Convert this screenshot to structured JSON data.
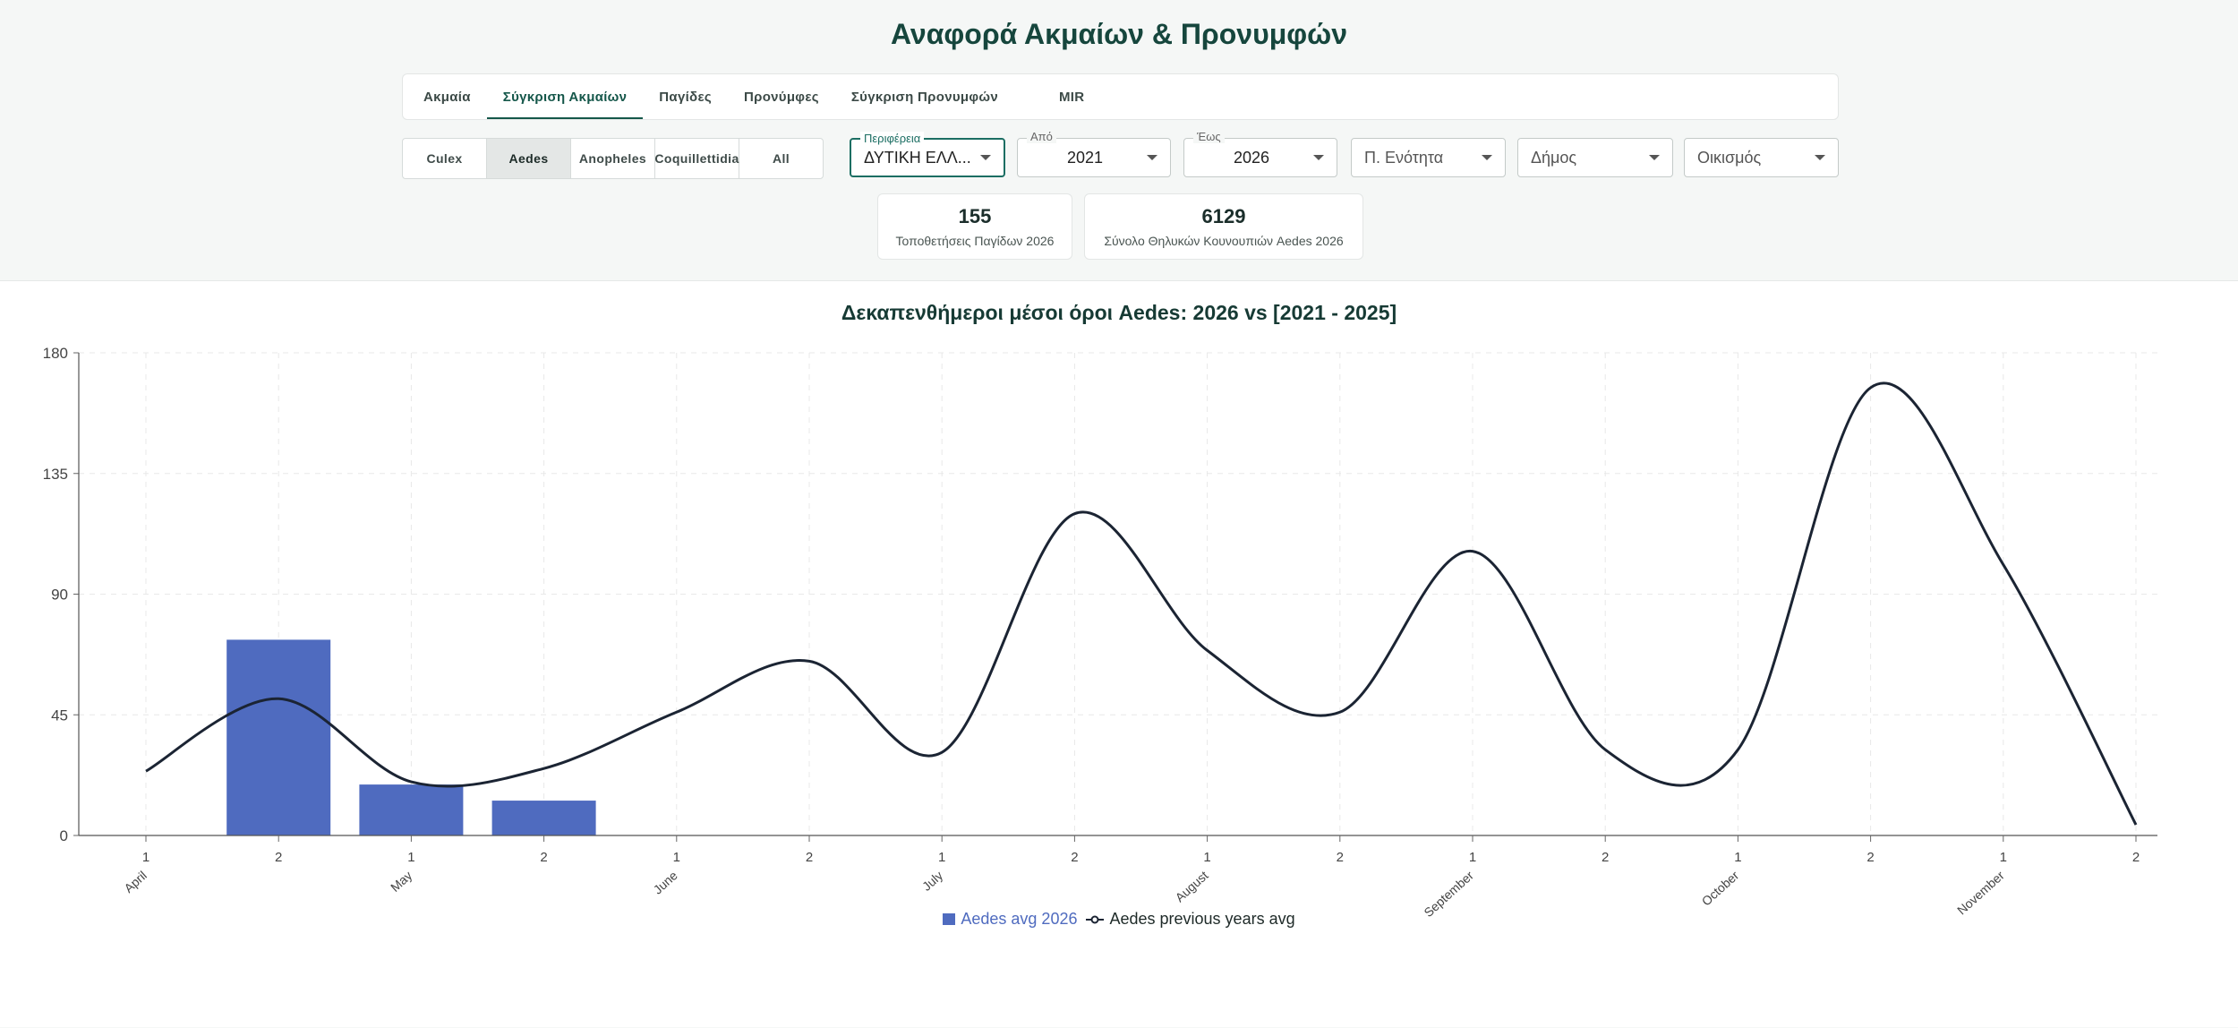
{
  "title": "Αναφορά Ακμαίων & Προνυμφών",
  "tabs": [
    {
      "label": "Ακμαία",
      "active": false
    },
    {
      "label": "Σύγκριση Ακμαίων",
      "active": true
    },
    {
      "label": "Παγίδες",
      "active": false
    },
    {
      "label": "Προνύμφες",
      "active": false
    },
    {
      "label": "Σύγκριση Προνυμφών",
      "active": false
    },
    {
      "label": "MIR",
      "active": false
    }
  ],
  "species": [
    "Culex",
    "Aedes",
    "Anopheles",
    "Coquillettidia",
    "All"
  ],
  "selected_species": "Aedes",
  "filters": {
    "region": {
      "label": "Περιφέρεια",
      "value": "ΔΥΤΙΚΗ ΕΛΛ..."
    },
    "from": {
      "label": "Από",
      "value": "2021"
    },
    "to": {
      "label": "Έως",
      "value": "2026"
    },
    "unit": {
      "placeholder": "Π. Ενότητα"
    },
    "municipality": {
      "placeholder": "Δήμος"
    },
    "settlement": {
      "placeholder": "Οικισμός"
    }
  },
  "stats": [
    {
      "value": "155",
      "label": "Τοποθετήσεις Παγίδων 2026"
    },
    {
      "value": "6129",
      "label": "Σύνολο Θηλυκών Κουνουπιών Aedes 2026"
    }
  ],
  "colors": {
    "accent": "#15574a",
    "bar": "#4f6bbf",
    "line": "#1b2433"
  },
  "chart_data": {
    "type": "bar",
    "title": "Δεκαπενθήμεροι μέσοι όροι Aedes: 2026 vs [2021 - 2025]",
    "xlabel": "",
    "ylabel": "",
    "ylim": [
      0,
      180
    ],
    "yticks": [
      0,
      45,
      90,
      135,
      180
    ],
    "grid": true,
    "legend": "bottom",
    "categories": [
      "1",
      "2",
      "1",
      "2",
      "1",
      "2",
      "1",
      "2",
      "1",
      "2",
      "1",
      "2",
      "1",
      "2",
      "1",
      "2"
    ],
    "month_labels": [
      "April",
      "May",
      "June",
      "July",
      "August",
      "September",
      "October",
      "November"
    ],
    "series": [
      {
        "name": "Aedes avg 2026",
        "type": "bar",
        "values": [
          null,
          73,
          19,
          13,
          null,
          null,
          null,
          null,
          null,
          null,
          null,
          null,
          null,
          null,
          null,
          null
        ]
      },
      {
        "name": "Aedes previous years avg",
        "type": "line",
        "values": [
          24,
          51,
          20,
          25,
          46,
          65,
          31,
          120,
          69,
          46,
          106,
          32,
          32,
          167,
          101,
          4
        ]
      }
    ]
  }
}
